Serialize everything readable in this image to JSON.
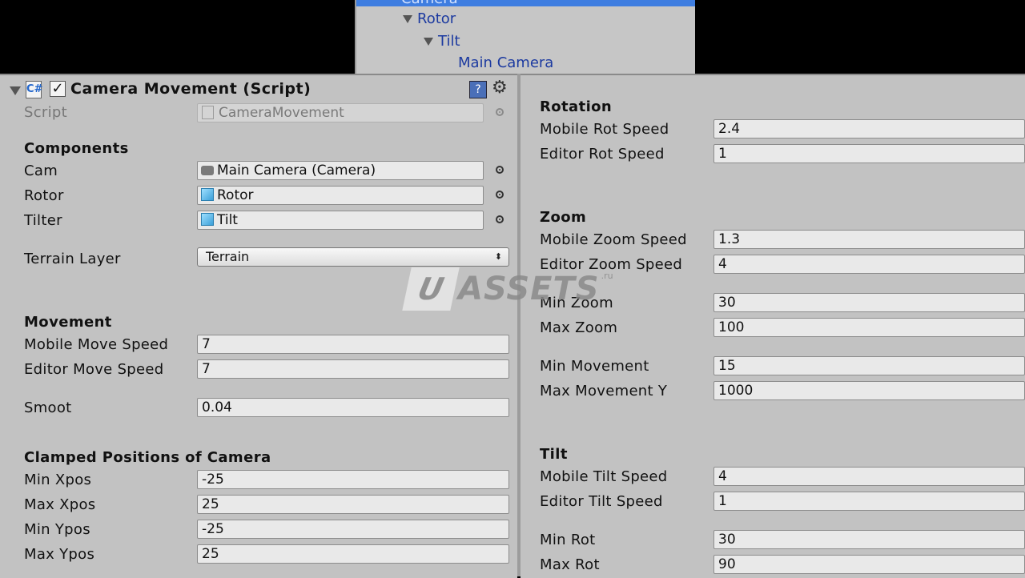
{
  "hierarchy": {
    "selected": "Camera",
    "nodes": [
      {
        "label": "Rotor"
      },
      {
        "label": "Tilt"
      },
      {
        "label": "Main Camera"
      }
    ]
  },
  "component": {
    "title": "Camera Movement (Script)",
    "enabled": true,
    "script_label": "Script",
    "script_value": "CameraMovement"
  },
  "left": {
    "components_header": "Components",
    "cam_label": "Cam",
    "cam_value": "Main Camera (Camera)",
    "rotor_label": "Rotor",
    "rotor_value": "Rotor",
    "tilter_label": "Tilter",
    "tilter_value": "Tilt",
    "terrain_label": "Terrain Layer",
    "terrain_value": "Terrain",
    "movement_header": "Movement",
    "mobile_move_label": "Mobile Move Speed",
    "mobile_move_value": "7",
    "editor_move_label": "Editor Move Speed",
    "editor_move_value": "7",
    "smoot_label": "Smoot",
    "smoot_value": "0.04",
    "clamped_header": "Clamped Positions of Camera",
    "min_xpos_label": "Min Xpos",
    "min_xpos_value": "-25",
    "max_xpos_label": "Max Xpos",
    "max_xpos_value": "25",
    "min_ypos_label": "Min Ypos",
    "min_ypos_value": "-25",
    "max_ypos_label": "Max Ypos",
    "max_ypos_value": "25"
  },
  "right": {
    "rotation_header": "Rotation",
    "mobile_rot_label": "Mobile Rot Speed",
    "mobile_rot_value": "2.4",
    "editor_rot_label": "Editor Rot Speed",
    "editor_rot_value": "1",
    "zoom_header": "Zoom",
    "mobile_zoom_label": "Mobile Zoom Speed",
    "mobile_zoom_value": "1.3",
    "editor_zoom_label": "Editor Zoom Speed",
    "editor_zoom_value": "4",
    "min_zoom_label": "Min Zoom",
    "min_zoom_value": "30",
    "max_zoom_label": "Max Zoom",
    "max_zoom_value": "100",
    "min_movement_label": "Min Movement",
    "min_movement_value": "15",
    "max_movement_y_label": "Max Movement Y",
    "max_movement_y_value": "1000",
    "tilt_header": "Tilt",
    "mobile_tilt_label": "Mobile Tilt Speed",
    "mobile_tilt_value": "4",
    "editor_tilt_label": "Editor Tilt Speed",
    "editor_tilt_value": "1",
    "min_rot_label": "Min Rot",
    "min_rot_value": "30",
    "max_rot_label": "Max Rot",
    "max_rot_value": "90"
  },
  "watermark": {
    "u": "U",
    "text": "ASSETS",
    "suffix": ".ru"
  },
  "icons": {
    "fold": "triangle-down-icon",
    "script": "csharp-script-icon",
    "help": "help-book-icon",
    "settings": "gear-icon",
    "picker": "object-picker-icon"
  }
}
